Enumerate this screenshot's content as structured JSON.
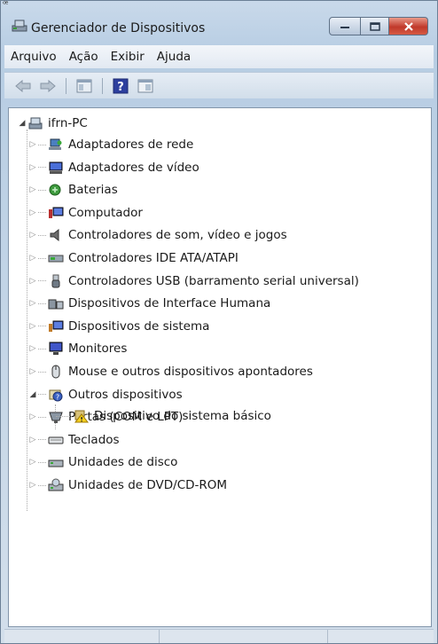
{
  "window": {
    "title": "Gerenciador de Dispositivos",
    "corner_glyph": "ꟹ"
  },
  "menu": [
    "Arquivo",
    "Ação",
    "Exibir",
    "Ajuda"
  ],
  "toolbar": {
    "icons": [
      "back-arrow-icon",
      "forward-arrow-icon",
      "show-hide-console-tree-icon",
      "help-icon",
      "properties-icon"
    ]
  },
  "tree": {
    "root": "ifrn-PC",
    "categories": [
      {
        "label": "Adaptadores de rede",
        "icon": "network-adapter-icon",
        "expanded": false
      },
      {
        "label": "Adaptadores de vídeo",
        "icon": "display-adapter-icon",
        "expanded": false
      },
      {
        "label": "Baterias",
        "icon": "battery-icon",
        "expanded": false
      },
      {
        "label": "Computador",
        "icon": "computer-icon",
        "expanded": false
      },
      {
        "label": "Controladores de som, vídeo e jogos",
        "icon": "speaker-icon",
        "expanded": false
      },
      {
        "label": "Controladores IDE ATA/ATAPI",
        "icon": "ide-controller-icon",
        "expanded": false
      },
      {
        "label": "Controladores USB (barramento serial universal)",
        "icon": "usb-icon",
        "expanded": false
      },
      {
        "label": "Dispositivos de Interface Humana",
        "icon": "hid-icon",
        "expanded": false
      },
      {
        "label": "Dispositivos de sistema",
        "icon": "system-device-icon",
        "expanded": false
      },
      {
        "label": "Monitores",
        "icon": "monitor-icon",
        "expanded": false
      },
      {
        "label": "Mouse e outros dispositivos apontadores",
        "icon": "mouse-icon",
        "expanded": false
      },
      {
        "label": "Outros dispositivos",
        "icon": "unknown-device-icon",
        "expanded": true
      },
      {
        "label": "Portas (COM e LPT)",
        "icon": "port-icon",
        "expanded": false
      },
      {
        "label": "Teclados",
        "icon": "keyboard-icon",
        "expanded": false
      },
      {
        "label": "Unidades de disco",
        "icon": "disk-drive-icon",
        "expanded": false
      },
      {
        "label": "Unidades de DVD/CD-ROM",
        "icon": "dvd-drive-icon",
        "expanded": false
      }
    ],
    "child": {
      "label": "Dispositivo do sistema básico",
      "icon": "warning-device-icon",
      "parent": "Outros dispositivos"
    }
  },
  "colors": {
    "title_bar": "#b7cde3",
    "close_button": "#c0392b",
    "tree_background": "#ffffff"
  }
}
